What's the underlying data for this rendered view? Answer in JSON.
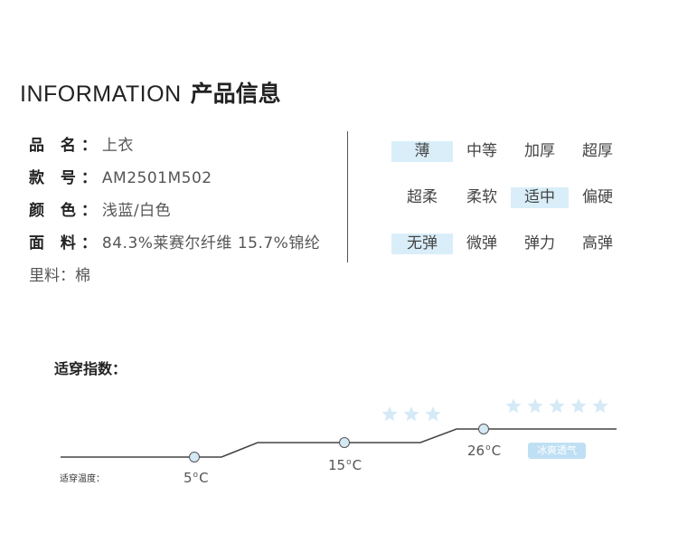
{
  "header": {
    "title_en": "INFORMATION",
    "title_zh": "产品信息"
  },
  "specs": [
    {
      "label": "品 名：",
      "value": "上衣"
    },
    {
      "label": "款 号：",
      "value": "AM2501M502"
    },
    {
      "label": "颜 色：",
      "value": "浅蓝/白色"
    },
    {
      "label": "面 料：",
      "value": "84.3%莱赛尔纤维 15.7%锦纶"
    },
    {
      "label": "里料：",
      "value": "棉"
    }
  ],
  "attributes": {
    "thickness": {
      "options": [
        "薄",
        "中等",
        "加厚",
        "超厚"
      ],
      "selected": "薄"
    },
    "softness": {
      "options": [
        "超柔",
        "柔软",
        "适中",
        "偏硬"
      ],
      "selected": "适中"
    },
    "elasticity": {
      "options": [
        "无弹",
        "微弹",
        "弹力",
        "高弹"
      ],
      "selected": "无弹"
    }
  },
  "wear_index": {
    "label": "适穿指数：",
    "axis_label": "适穿温度：",
    "unit": "C",
    "degree_mark": "o",
    "temperatures": [
      "5",
      "15",
      "26"
    ],
    "stars_mid": 3,
    "stars_high": 5,
    "badge": "冰爽透气",
    "colors": {
      "line": "#444444",
      "dot": "#d5e9f5",
      "star": "#d5eaf7",
      "badge": "#bfe0f4",
      "select": "#d9eef9"
    }
  }
}
